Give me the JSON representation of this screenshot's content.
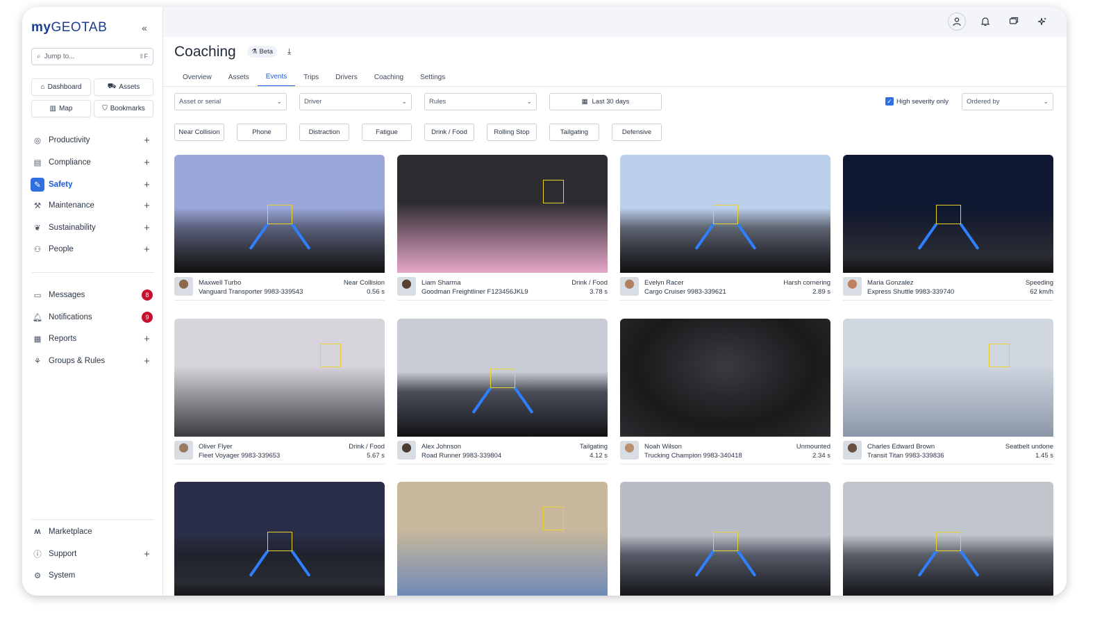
{
  "app": {
    "logo_prefix": "my",
    "logo_name": "GEOTAB"
  },
  "sidebar": {
    "search_placeholder": "Jump to...",
    "search_shortcut": "⇧F",
    "quick_links": [
      "Dashboard",
      "Assets",
      "Map",
      "Bookmarks"
    ],
    "items": [
      {
        "label": "Productivity",
        "icon": "globe-icon",
        "action": "+"
      },
      {
        "label": "Compliance",
        "icon": "clipboard-icon",
        "action": "+"
      },
      {
        "label": "Safety",
        "icon": "pen-tool-icon",
        "action": "+",
        "active": true
      },
      {
        "label": "Maintenance",
        "icon": "wrench-icon",
        "action": "+"
      },
      {
        "label": "Sustainability",
        "icon": "leaf-icon",
        "action": "+"
      },
      {
        "label": "People",
        "icon": "people-icon",
        "action": "+"
      },
      {
        "label": "Messages",
        "icon": "messages-icon",
        "badge": "8"
      },
      {
        "label": "Notifications",
        "icon": "bell-icon",
        "badge": "9"
      },
      {
        "label": "Reports",
        "icon": "report-icon",
        "action": "+"
      },
      {
        "label": "Groups & Rules",
        "icon": "groups-icon",
        "action": "+"
      }
    ],
    "footer": [
      {
        "label": "Marketplace",
        "icon": "marketplace-icon"
      },
      {
        "label": "Support",
        "icon": "help-icon",
        "action": "+"
      },
      {
        "label": "System",
        "icon": "gear-icon"
      }
    ]
  },
  "header": {
    "title": "Coaching",
    "badge": "Beta",
    "tabs": [
      "Overview",
      "Assets",
      "Events",
      "Trips",
      "Drivers",
      "Coaching",
      "Settings"
    ],
    "active_tab": "Events"
  },
  "filters": {
    "asset": "Asset or serial",
    "driver": "Driver",
    "rules": "Rules",
    "date": "Last 30 days",
    "high_severity_label": "High severity only",
    "high_severity_checked": true,
    "order": "Ordered by",
    "chips": [
      "Near Collision",
      "Phone",
      "Distraction",
      "Fatigue",
      "Drink / Food",
      "Rolling Stop",
      "Tailgating",
      "Defensive"
    ]
  },
  "events": [
    {
      "driver": "Maxwell Turbo",
      "vehicle": "Vanguard Transporter 9983-339543",
      "event": "Near Collision",
      "value": "0.56 s",
      "scene": "road-day",
      "sky": "#9aa7d8",
      "ground": "#5a5f7a",
      "avatar": "#8a6a4a"
    },
    {
      "driver": "Liam Sharma",
      "vehicle": "Goodman Freightliner F123456JKL9",
      "event": "Drink / Food",
      "value": "3.78 s",
      "scene": "cabin",
      "sky": "#2b2b30",
      "ground": "#e7a7c8",
      "avatar": "#5a4030"
    },
    {
      "driver": "Evelyn Racer",
      "vehicle": "Cargo Cruiser 9983-339621",
      "event": "Harsh cornering",
      "value": "2.89 s",
      "scene": "road-day",
      "sky": "#bcd0ec",
      "ground": "#5d6470",
      "avatar": "#b08060"
    },
    {
      "driver": "Maria Gonzalez",
      "vehicle": "Express Shuttle 9983-339740",
      "event": "Speeding",
      "value": "62 km/h",
      "scene": "road-night",
      "sky": "#0e1830",
      "ground": "#1c2030",
      "avatar": "#c08060"
    },
    {
      "driver": "Oliver Flyer",
      "vehicle": "Fleet Voyager 9983-339653",
      "event": "Drink / Food",
      "value": "5.67 s",
      "scene": "cabin",
      "sky": "#d8d4dc",
      "ground": "#3a3a40",
      "avatar": "#9a7a60"
    },
    {
      "driver": "Alex Johnson",
      "vehicle": "Road Runner 9983-339804",
      "event": "Tailgating",
      "value": "4.12 s",
      "scene": "road-day",
      "sky": "#c8ccd4",
      "ground": "#4a4e58",
      "avatar": "#4a3a30"
    },
    {
      "driver": "Noah Wilson",
      "vehicle": "Trucking Champion 9983-340418",
      "event": "Unmounted",
      "value": "2.34 s",
      "scene": "dark",
      "sky": "#1a1a1c",
      "ground": "#2c2c30",
      "avatar": "#b89070"
    },
    {
      "driver": "Charles Edward Brown",
      "vehicle": "Transit Titan 9983-339836",
      "event": "Seatbelt undone",
      "value": "1.45 s",
      "scene": "cabin",
      "sky": "#cfd6e0",
      "ground": "#8b97a8",
      "avatar": "#6a5040"
    },
    {
      "driver": "",
      "vehicle": "",
      "event": "",
      "value": "",
      "scene": "road-night",
      "sky": "#2a2e48",
      "ground": "#20222c",
      "avatar": ""
    },
    {
      "driver": "",
      "vehicle": "",
      "event": "",
      "value": "",
      "scene": "cabin",
      "sky": "#c9b89c",
      "ground": "#6a87b8",
      "avatar": ""
    },
    {
      "driver": "",
      "vehicle": "",
      "event": "",
      "value": "",
      "scene": "road-day",
      "sky": "#b8bcc6",
      "ground": "#555a66",
      "avatar": ""
    },
    {
      "driver": "",
      "vehicle": "",
      "event": "",
      "value": "",
      "scene": "road-day",
      "sky": "#c0c6cc",
      "ground": "#5a5e68",
      "avatar": ""
    }
  ],
  "colors": {
    "accent": "#1b59d8",
    "badge": "#c8102e",
    "brand": "#1b3d8f"
  }
}
